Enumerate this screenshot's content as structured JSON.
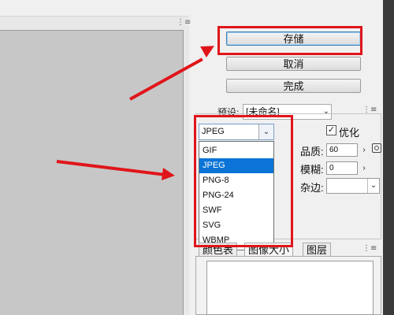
{
  "buttons": {
    "save": "存储",
    "cancel": "取消",
    "done": "完成"
  },
  "preset": {
    "label": "预设:",
    "value": "[未命名]"
  },
  "format": {
    "selected": "JPEG",
    "options": [
      "GIF",
      "JPEG",
      "PNG-8",
      "PNG-24",
      "SWF",
      "SVG",
      "WBMP"
    ],
    "highlighted_index": 1
  },
  "settings": {
    "optimize_label": "优化",
    "optimize_checked": true,
    "quality_label": "品质:",
    "quality_value": "60",
    "blur_label": "模糊:",
    "blur_value": "0",
    "matte_label": "杂边:",
    "matte_value": ""
  },
  "tabs": [
    {
      "label": "颜色表",
      "active": false
    },
    {
      "label": "图像大小",
      "active": true
    },
    {
      "label": "图层",
      "active": false
    }
  ],
  "icons": {
    "panel_grip": "⋮≡",
    "dropdown_caret": "⌄",
    "stepper_arrow": "›",
    "checkbox_check": "☑"
  },
  "colors": {
    "annotation_red": "#e0151a",
    "selection_blue": "#0b74d6",
    "canvas_gray": "#c7c7c7"
  }
}
